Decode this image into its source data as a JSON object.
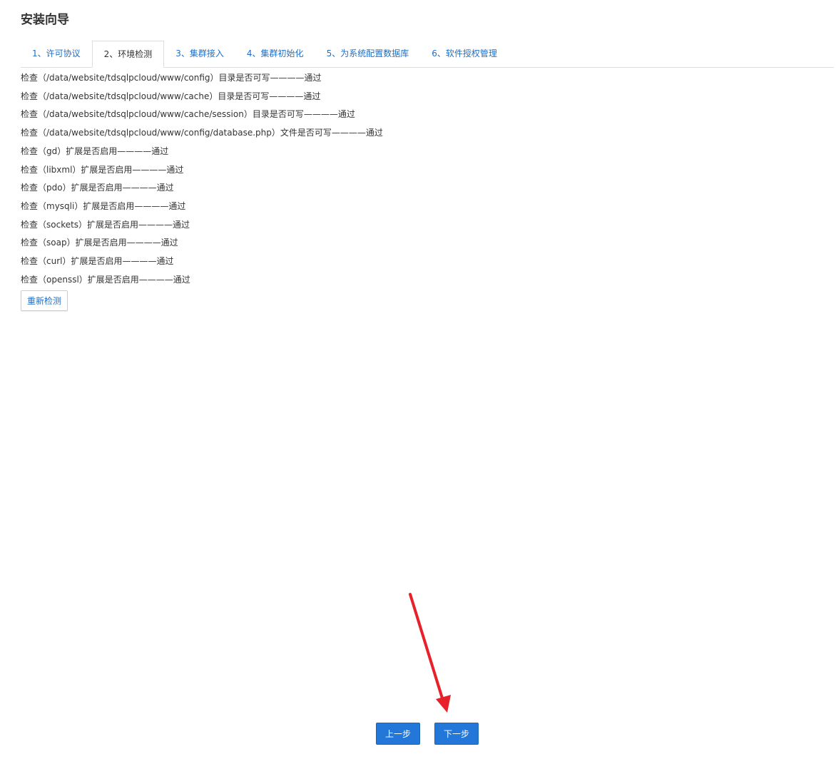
{
  "page": {
    "title": "安装向导"
  },
  "tabs": [
    {
      "label": "1、许可协议",
      "active": false
    },
    {
      "label": "2、环境检测",
      "active": true
    },
    {
      "label": "3、集群接入",
      "active": false
    },
    {
      "label": "4、集群初始化",
      "active": false
    },
    {
      "label": "5、为系统配置数据库",
      "active": false
    },
    {
      "label": "6、软件授权管理",
      "active": false
    }
  ],
  "checks": [
    "检查（/data/website/tdsqlpcloud/www/config）目录是否可写————通过",
    "检查（/data/website/tdsqlpcloud/www/cache）目录是否可写————通过",
    "检查（/data/website/tdsqlpcloud/www/cache/session）目录是否可写————通过",
    "检查（/data/website/tdsqlpcloud/www/config/database.php）文件是否可写————通过",
    "检查（gd）扩展是否启用————通过",
    "检查（libxml）扩展是否启用————通过",
    "检查（pdo）扩展是否启用————通过",
    "检查（mysqli）扩展是否启用————通过",
    "检查（sockets）扩展是否启用————通过",
    "检查（soap）扩展是否启用————通过",
    "检查（curl）扩展是否启用————通过",
    "检查（openssl）扩展是否启用————通过"
  ],
  "buttons": {
    "recheck": "重新检测",
    "prev": "上一步",
    "next": "下一步"
  },
  "colors": {
    "link": "#1e6fc8",
    "primary": "#2277d8",
    "annotation": "#e8202a"
  },
  "icons": {
    "annotation": "red-arrow-icon"
  }
}
